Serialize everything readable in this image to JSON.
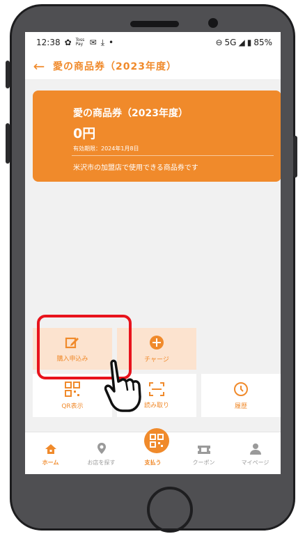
{
  "status_bar": {
    "time": "12:38",
    "pay_label": "Toss Pay",
    "network": "5G",
    "battery": "85%"
  },
  "app_bar": {
    "back_icon": "arrow-left-icon",
    "title": "愛の商品券（2023年度）"
  },
  "voucher_card": {
    "name": "愛の商品券（2023年度）",
    "amount": "0円",
    "expiry": "有効期限：2024年1月8日",
    "description": "米沢市の加盟店で使用できる商品券です"
  },
  "actions": [
    {
      "label": "購入申込み",
      "icon": "edit-icon"
    },
    {
      "label": "チャージ",
      "icon": "plus-circle-icon"
    },
    {
      "label": "QR表示",
      "icon": "qr-code-icon"
    },
    {
      "label": "読み取り",
      "icon": "scan-icon"
    },
    {
      "label": "履歴",
      "icon": "clock-icon"
    }
  ],
  "bottom_nav": [
    {
      "label": "ホーム",
      "icon": "home-icon",
      "active": true
    },
    {
      "label": "お店を探す",
      "icon": "location-pin-icon",
      "active": false
    },
    {
      "label": "支払う",
      "icon": "pay-qr-icon",
      "active": false
    },
    {
      "label": "クーポン",
      "icon": "ticket-icon",
      "active": false
    },
    {
      "label": "マイページ",
      "icon": "person-icon",
      "active": false
    }
  ],
  "colors": {
    "accent": "#f08a2b",
    "highlight": "#e8131c",
    "phone_body": "#4f4f52"
  }
}
